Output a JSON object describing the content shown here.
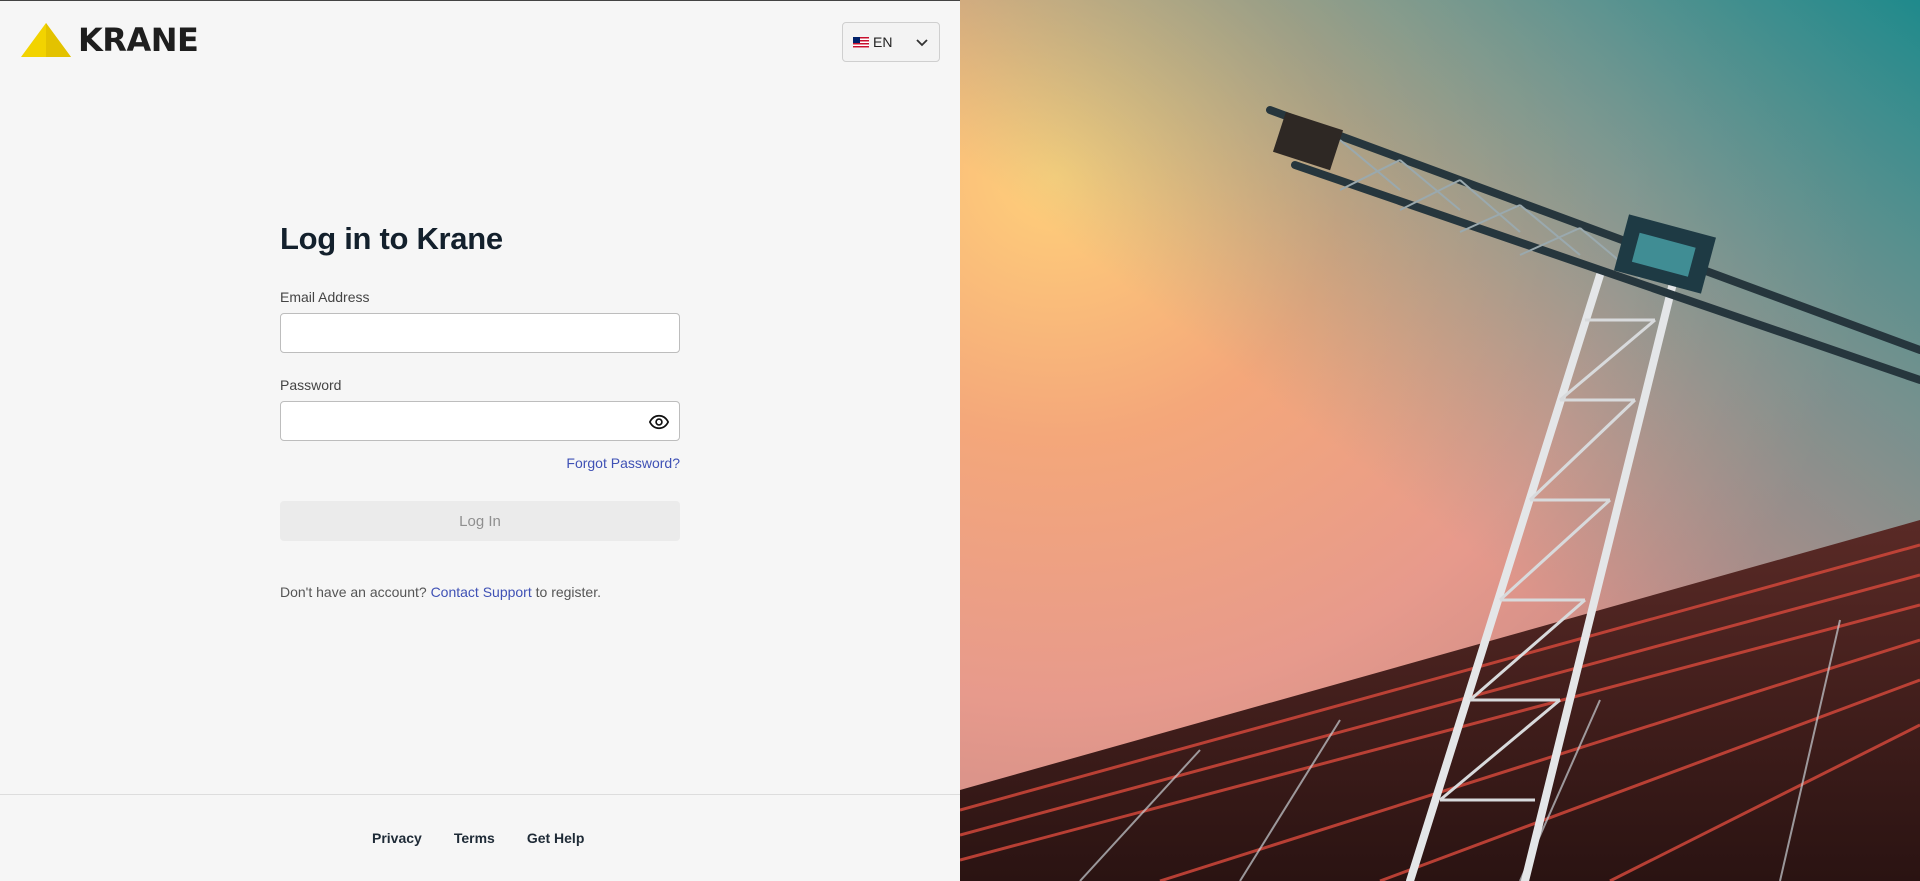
{
  "brand": {
    "name": "KRANE"
  },
  "language": {
    "code": "EN",
    "flag": "us-flag-icon"
  },
  "login": {
    "title": "Log in to Krane",
    "email_label": "Email Address",
    "email_value": "",
    "password_label": "Password",
    "password_value": "",
    "forgot_link": "Forgot Password?",
    "submit_label": "Log In",
    "register_prefix": "Don't have an account?",
    "register_link": "Contact Support",
    "register_suffix": "to register."
  },
  "footer": {
    "links": [
      "Privacy",
      "Terms",
      "Get Help"
    ]
  },
  "colors": {
    "accent": "#3f51b5",
    "logo_yellow": "#f2d300",
    "title": "#13202c"
  },
  "hero": {
    "subject": "tower crane against a sky"
  }
}
